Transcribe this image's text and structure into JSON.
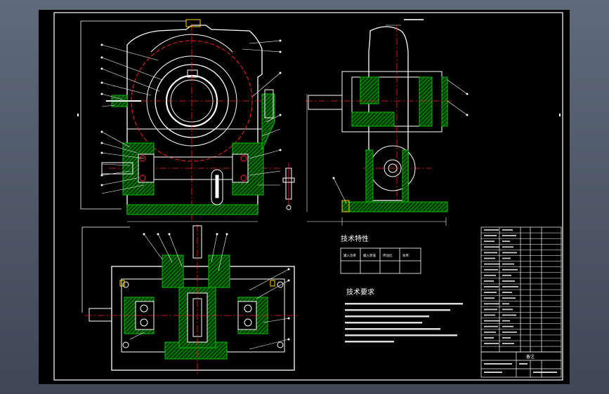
{
  "viewport": {
    "background_top": "#5f6a7a",
    "background_bottom": "#3e4756",
    "sheet_color": "#000000"
  },
  "colors": {
    "outline": "#ffffff",
    "hatch": "#00c000",
    "center": "#ff2020",
    "dim": "#ffffff",
    "accent": "#ffd700"
  },
  "sections": {
    "tech_params_title": "技术特性",
    "tech_requirements_title": "技术要求"
  },
  "tech_params_table": {
    "headers": [
      "输入功率",
      "输入转速",
      "传动比",
      "效率"
    ],
    "values": [
      "",
      "",
      "",
      ""
    ]
  },
  "tech_requirements": [
    "",
    "",
    "",
    "",
    "",
    "",
    ""
  ],
  "title_block": {
    "label": "备注"
  }
}
